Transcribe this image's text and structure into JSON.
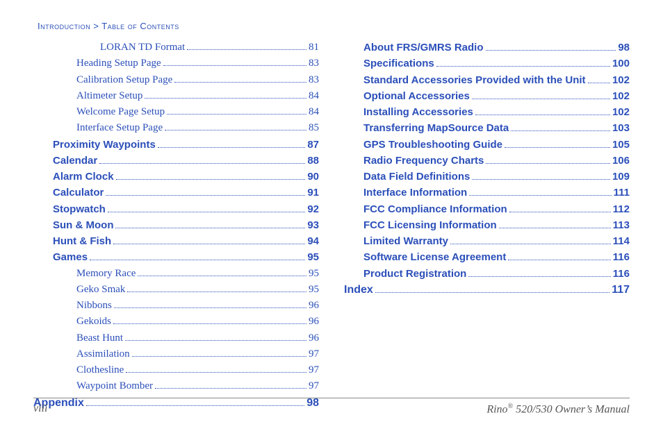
{
  "breadcrumb": {
    "part1": "Introduction",
    "sep": " > ",
    "part2": "Table of Contents"
  },
  "left": [
    {
      "level": 4,
      "label": "LORAN TD Format",
      "page": "81"
    },
    {
      "level": 3,
      "label": "Heading Setup Page",
      "page": "83"
    },
    {
      "level": 3,
      "label": "Calibration Setup Page ",
      "page": "83"
    },
    {
      "level": 3,
      "label": "Altimeter Setup",
      "page": "84"
    },
    {
      "level": 3,
      "label": "Welcome Page Setup",
      "page": "84"
    },
    {
      "level": 3,
      "label": "Interface Setup Page",
      "page": "85"
    },
    {
      "level": 2,
      "label": "Proximity Waypoints",
      "page": "87"
    },
    {
      "level": 2,
      "label": "Calendar",
      "page": "88"
    },
    {
      "level": 2,
      "label": "Alarm Clock",
      "page": "90"
    },
    {
      "level": 2,
      "label": "Calculator",
      "page": "91"
    },
    {
      "level": 2,
      "label": "Stopwatch",
      "page": "92"
    },
    {
      "level": 2,
      "label": "Sun & Moon",
      "page": "93"
    },
    {
      "level": 2,
      "label": "Hunt & Fish",
      "page": "94"
    },
    {
      "level": 2,
      "label": "Games",
      "page": "95"
    },
    {
      "level": 3,
      "label": "Memory Race",
      "page": "95"
    },
    {
      "level": 3,
      "label": "Geko Smak",
      "page": "95"
    },
    {
      "level": 3,
      "label": "Nibbons",
      "page": "96"
    },
    {
      "level": 3,
      "label": "Gekoids",
      "page": "96"
    },
    {
      "level": 3,
      "label": "Beast Hunt",
      "page": "96"
    },
    {
      "level": 3,
      "label": "Assimilation",
      "page": "97"
    },
    {
      "level": 3,
      "label": "Clothesline",
      "page": "97"
    },
    {
      "level": 3,
      "label": "Waypoint Bomber",
      "page": "97"
    },
    {
      "level": 1,
      "label": "Appendix",
      "page": "98"
    }
  ],
  "right": [
    {
      "level": 2,
      "label": "About FRS/GMRS Radio",
      "page": "98"
    },
    {
      "level": 2,
      "label": "Specifications",
      "page": "100"
    },
    {
      "level": 2,
      "label": "Standard Accessories Provided with the Unit",
      "page": "102"
    },
    {
      "level": 2,
      "label": "Optional Accessories",
      "page": "102"
    },
    {
      "level": 2,
      "label": "Installing Accessories",
      "page": "102"
    },
    {
      "level": 2,
      "label": "Transferring MapSource Data",
      "page": "103"
    },
    {
      "level": 2,
      "label": "GPS Troubleshooting Guide",
      "page": "105"
    },
    {
      "level": 2,
      "label": "Radio Frequency Charts",
      "page": "106"
    },
    {
      "level": 2,
      "label": "Data Field Definitions",
      "page": "109"
    },
    {
      "level": 2,
      "label": "Interface Information",
      "page": "111"
    },
    {
      "level": 2,
      "label": "FCC Compliance Information",
      "page": "112"
    },
    {
      "level": 2,
      "label": "FCC Licensing Information",
      "page": "113"
    },
    {
      "level": 2,
      "label": "Limited Warranty",
      "page": "114"
    },
    {
      "level": 2,
      "label": "Software License Agreement",
      "page": "116"
    },
    {
      "level": 2,
      "label": "Product Registration",
      "page": "116"
    },
    {
      "level": 1,
      "label": "Index",
      "page": "117"
    }
  ],
  "footer": {
    "pageNumeral": "viii",
    "product": "Rino",
    "model": " 520/530 Owner’s Manual"
  }
}
